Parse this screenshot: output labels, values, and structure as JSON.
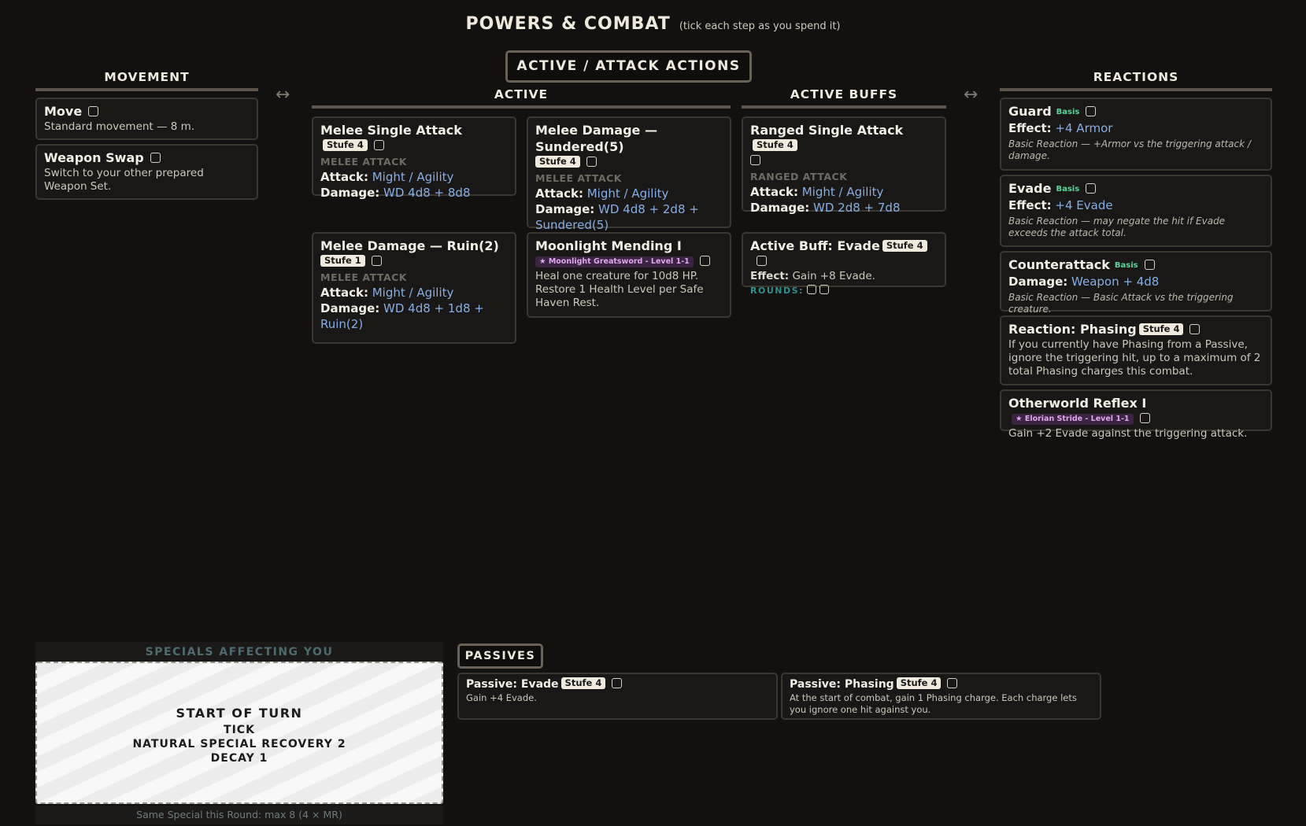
{
  "page": {
    "title": "POWERS & COMBAT",
    "subtitle": "(tick each step as you spend it)"
  },
  "colors": {
    "background": "#121110",
    "card": "#1a1816",
    "value_blue": "#86aee5",
    "basis_green": "#59d49a",
    "source_purple": "#e0a7ef",
    "rounds_teal": "#2f8f8a"
  },
  "icons": {
    "swap": "↔"
  },
  "labels": {
    "attack": "Attack:",
    "damage": "Damage:",
    "effect": "Effect:"
  },
  "movement": {
    "header": "MOVEMENT",
    "move": {
      "name": "Move",
      "desc": "Standard movement — 8 m."
    },
    "weapon_swap": {
      "name": "Weapon Swap",
      "desc": "Switch to your other prepared Weapon Set."
    }
  },
  "actions": {
    "header": "ACTIVE / ATTACK ACTIONS",
    "active_header": "ACTIVE",
    "buffs_header": "ACTIVE BUFFS",
    "melee_single": {
      "name": "Melee Single Attack",
      "badge": "Stufe 4",
      "type": "MELEE ATTACK",
      "attack": "Might / Agility",
      "damage": "WD 4d8 + 8d8"
    },
    "melee_sundered": {
      "name": "Melee Damage — Sundered(5)",
      "badge": "Stufe 4",
      "type": "MELEE ATTACK",
      "attack": "Might / Agility",
      "damage": "WD 4d8 + 2d8 + Sundered(5)"
    },
    "melee_ruin": {
      "name": "Melee Damage — Ruin(2)",
      "badge": "Stufe 1",
      "type": "MELEE ATTACK",
      "attack": "Might / Agility",
      "damage": "WD 4d8 + 1d8 + Ruin(2)"
    },
    "moonlight": {
      "name": "Moonlight Mending I",
      "source": "★ Moonlight Greatsword - Level 1-1",
      "desc": "Heal one creature for 10d8 HP. Restore 1 Health Level per Safe Haven Rest."
    },
    "ranged_single": {
      "name": "Ranged Single Attack",
      "badge": "Stufe 4",
      "type": "RANGED ATTACK",
      "attack": "Might / Agility",
      "damage": "WD 2d8 + 7d8"
    },
    "buff_evade": {
      "name": "Active Buff: Evade",
      "badge": "Stufe 4",
      "effect_label": "Effect:",
      "effect": "Gain +8 Evade.",
      "rounds_label": "ROUNDS:"
    }
  },
  "reactions": {
    "header": "REACTIONS",
    "guard": {
      "name": "Guard",
      "badge": "Basis",
      "effect": "+4 Armor",
      "note": "Basic Reaction — +Armor vs the triggering attack / damage."
    },
    "evade": {
      "name": "Evade",
      "badge": "Basis",
      "effect": "+4 Evade",
      "note": "Basic Reaction — may negate the hit if Evade exceeds the attack total."
    },
    "counter": {
      "name": "Counterattack",
      "badge": "Basis",
      "damage": "Weapon + 4d8",
      "note": "Basic Reaction — Basic Attack vs the triggering creature."
    },
    "phasing": {
      "name": "Reaction: Phasing",
      "badge": "Stufe 4",
      "desc": "If you currently have Phasing from a Passive, ignore the triggering hit, up to a maximum of 2 total Phasing charges this combat."
    },
    "otherworld": {
      "name": "Otherworld Reflex I",
      "source": "★ Elorian Stride - Level 1-1",
      "desc": "Gain +2 Evade against the triggering attack."
    }
  },
  "specials": {
    "header": "SPECIALS AFFECTING YOU",
    "line1": "START OF TURN",
    "line2": "TICK",
    "line3": "NATURAL SPECIAL RECOVERY 2",
    "line4": "DECAY 1",
    "footer": "Same Special this Round: max 8 (4 × MR)"
  },
  "passives": {
    "header": "PASSIVES",
    "evade": {
      "name": "Passive: Evade",
      "badge": "Stufe 4",
      "desc": "Gain +4 Evade."
    },
    "phasing": {
      "name": "Passive: Phasing",
      "badge": "Stufe 4",
      "desc": "At the start of combat, gain 1 Phasing charge. Each charge lets you ignore one hit against you."
    }
  }
}
